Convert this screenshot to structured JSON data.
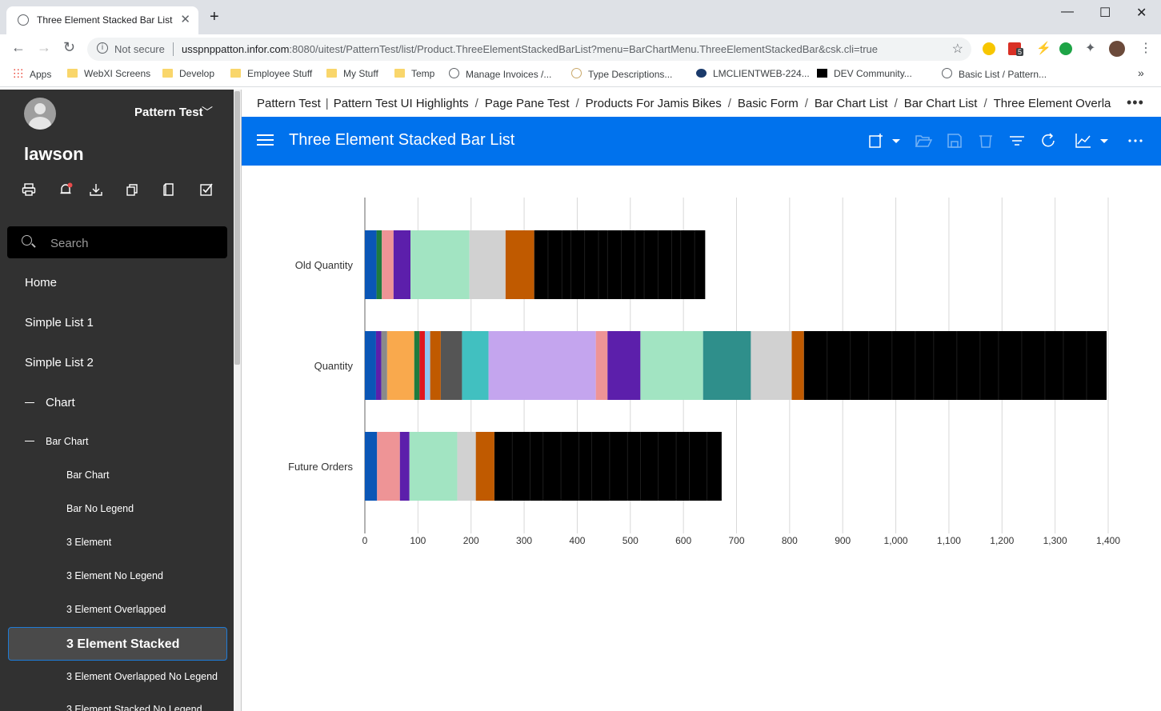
{
  "browser": {
    "tab_title": "Three Element Stacked Bar List / Ir",
    "not_secure": "Not secure",
    "url_host": "usspnppatton.infor.com",
    "url_rest": ":8080/uitest/PatternTest/list/Product.ThreeElementStackedBarList?menu=BarChartMenu.ThreeElementStackedBar&csk.cli=true",
    "extension_badge": "5",
    "bookmarks": [
      "Apps",
      "WebXI Screens",
      "Develop",
      "Employee Stuff",
      "My Stuff",
      "Temp",
      "Manage Invoices /...",
      "Type Descriptions...",
      "LMCLIENTWEB-224...",
      "DEV Community...",
      "Basic List / Pattern..."
    ]
  },
  "sidebar": {
    "app_name": "Pattern Test",
    "user": "lawson",
    "search_placeholder": "Search",
    "icons": [
      "print-icon",
      "notification-icon",
      "download-icon",
      "copy-icon",
      "document-icon",
      "checkbox-icon"
    ],
    "nav": {
      "home": "Home",
      "simple_list_1": "Simple List 1",
      "simple_list_2": "Simple List 2",
      "chart": "Chart",
      "bar_chart_group": "Bar Chart",
      "items": [
        "Bar Chart",
        "Bar No Legend",
        "3 Element",
        "3 Element No Legend",
        "3 Element Overlapped",
        "3 Element Stacked",
        "3 Element Overlapped No Legend",
        "3 Element Stacked No Legend"
      ]
    }
  },
  "breadcrumbs": [
    "Pattern Test",
    "Pattern Test UI Highlights",
    "Page Pane Test",
    "Products For Jamis Bikes",
    "Basic Form",
    "Bar Chart List",
    "Bar Chart List",
    "Three Element Overla"
  ],
  "page_title": "Three Element Stacked Bar List",
  "header_icons": [
    "create-icon",
    "open-icon",
    "save-icon",
    "delete-icon",
    "filter-icon",
    "refresh-icon",
    "chart-icon",
    "more-icon"
  ],
  "chart_data": {
    "type": "bar",
    "orientation": "horizontal",
    "stacked": true,
    "categories": [
      "Old Quantity",
      "Quantity",
      "Future Orders"
    ],
    "xlim": [
      0,
      1400
    ],
    "xticks": [
      "0",
      "100",
      "200",
      "300",
      "400",
      "500",
      "600",
      "700",
      "800",
      "900",
      "1,000",
      "1,100",
      "1,200",
      "1,300",
      "1,400"
    ],
    "grid": true,
    "legend": "none",
    "segments": [
      [
        {
          "value": 22,
          "color": "#0a56b6"
        },
        {
          "value": 10,
          "color": "#1e7b3e"
        },
        {
          "value": 22,
          "color": "#ee9496"
        },
        {
          "value": 32,
          "color": "#5c1fab"
        },
        {
          "value": 111,
          "color": "#a2e4c2"
        },
        {
          "value": 68,
          "color": "#d1d1d1"
        },
        {
          "value": 54,
          "color": "#c05a00"
        },
        {
          "value": 322,
          "color": "#000000"
        }
      ],
      [
        {
          "value": 21,
          "color": "#0a56b6"
        },
        {
          "value": 10,
          "color": "#5c1fab"
        },
        {
          "value": 11,
          "color": "#8a8a8a"
        },
        {
          "value": 51,
          "color": "#f9a94d"
        },
        {
          "value": 10,
          "color": "#1e7b3e"
        },
        {
          "value": 10,
          "color": "#e0161f"
        },
        {
          "value": 10,
          "color": "#8fc5f2"
        },
        {
          "value": 20,
          "color": "#c05a00"
        },
        {
          "value": 40,
          "color": "#555555"
        },
        {
          "value": 50,
          "color": "#41c0c0"
        },
        {
          "value": 202,
          "color": "#c4a5ee"
        },
        {
          "value": 22,
          "color": "#ee9496"
        },
        {
          "value": 62,
          "color": "#5c1fab"
        },
        {
          "value": 118,
          "color": "#a2e4c2"
        },
        {
          "value": 90,
          "color": "#2f8f8b"
        },
        {
          "value": 77,
          "color": "#d1d1d1"
        },
        {
          "value": 23,
          "color": "#c05a00"
        },
        {
          "value": 570,
          "color": "#000000"
        }
      ],
      [
        {
          "value": 23,
          "color": "#0a56b6"
        },
        {
          "value": 43,
          "color": "#ee9496"
        },
        {
          "value": 18,
          "color": "#5c1fab"
        },
        {
          "value": 90,
          "color": "#a2e4c2"
        },
        {
          "value": 35,
          "color": "#d1d1d1"
        },
        {
          "value": 35,
          "color": "#c05a00"
        },
        {
          "value": 428,
          "color": "#000000"
        }
      ]
    ]
  }
}
